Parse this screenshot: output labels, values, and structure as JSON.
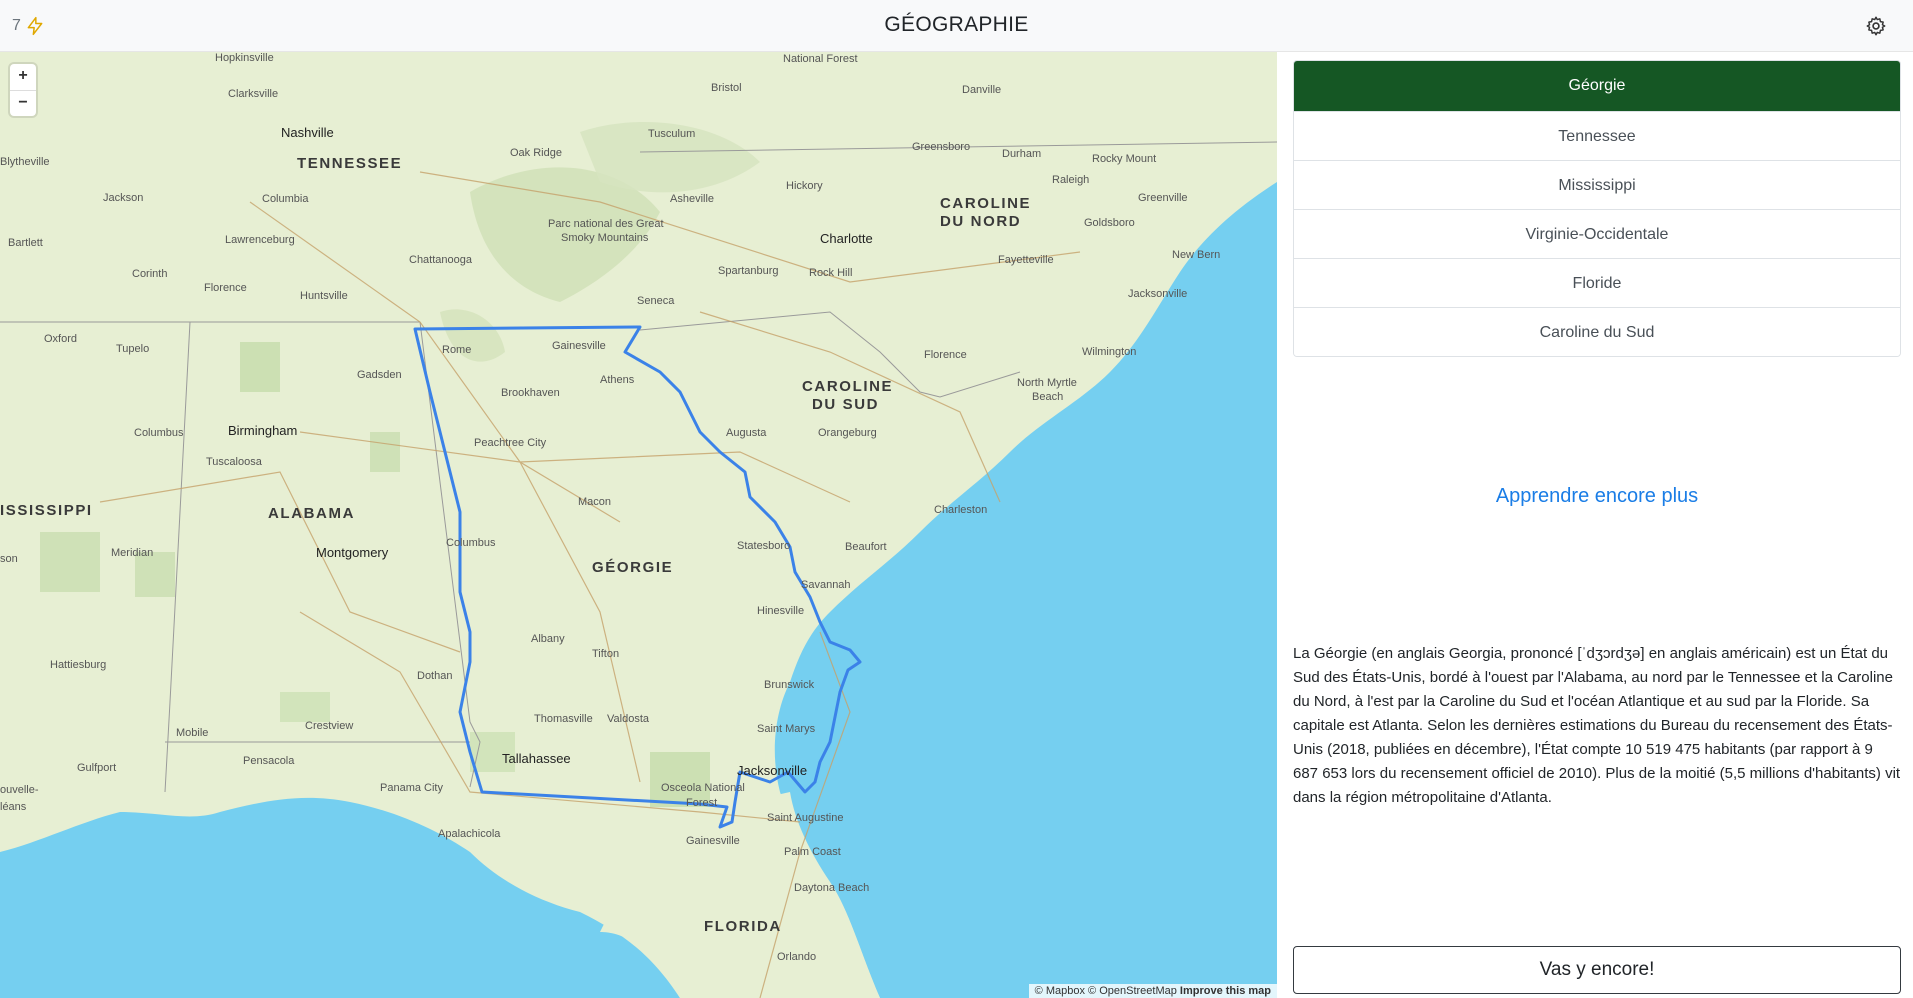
{
  "header": {
    "streak_count": "7",
    "title": "GÉOGRAPHIE"
  },
  "icons": {
    "streak": "lightning-bolt-icon",
    "settings": "gear-icon"
  },
  "map": {
    "zoom_in": "+",
    "zoom_out": "−",
    "attribution": {
      "mapbox": "© Mapbox",
      "osm": "© OpenStreetMap",
      "improve": "Improve this map"
    },
    "highlight_color": "#3b82e8",
    "water_color": "#75cff0",
    "land_color": "#e7efd3",
    "state_labels": {
      "tennessee": "TENNESSEE",
      "caroline_nord_1": "CAROLINE",
      "caroline_nord_2": "DU NORD",
      "caroline_sud_1": "CAROLINE",
      "caroline_sud_2": "DU SUD",
      "mississippi": "ISSISSIPPI",
      "alabama": "ALABAMA",
      "georgie": "GÉORGIE",
      "florida": "FLORIDA"
    },
    "places": {
      "hopkinsville": "Hopkinsville",
      "clarksville": "Clarksville",
      "nashville": "Nashville",
      "blytheville": "Blytheville",
      "jackson_tn": "Jackson",
      "columbia": "Columbia",
      "lawrenceburg": "Lawrenceburg",
      "bartlett": "Bartlett",
      "corinth": "Corinth",
      "florence_al": "Florence",
      "huntsville": "Huntsville",
      "chattanooga": "Chattanooga",
      "oxford": "Oxford",
      "tupelo": "Tupelo",
      "gadsden": "Gadsden",
      "rome": "Rome",
      "gainesville_ga": "Gainesville",
      "columbus_ms": "Columbus",
      "birmingham": "Birmingham",
      "tuscaloosa": "Tuscaloosa",
      "brookhaven": "Brookhaven",
      "athens": "Athens",
      "peachtree": "Peachtree City",
      "national_forest": "National Forest",
      "bristol": "Bristol",
      "danville": "Danville",
      "oak_ridge": "Oak Ridge",
      "tusculum": "Tusculum",
      "greensboro": "Greensboro",
      "durham": "Durham",
      "rocky_mount": "Rocky Mount",
      "raleigh": "Raleigh",
      "asheville": "Asheville",
      "hickory": "Hickory",
      "greenville": "Greenville",
      "smoky_1": "Parc national des Great",
      "smoky_2": "Smoky Mountains",
      "charlotte": "Charlotte",
      "goldsboro": "Goldsboro",
      "spartanburg": "Spartanburg",
      "rock_hill": "Rock Hill",
      "fayetteville": "Fayetteville",
      "new_bern": "New Bern",
      "seneca": "Seneca",
      "jacksonville_nc": "Jacksonville",
      "wilmington": "Wilmington",
      "florence_sc": "Florence",
      "myrtle_1": "North Myrtle",
      "myrtle_2": "Beach",
      "augusta": "Augusta",
      "orangeburg": "Orangeburg",
      "charleston": "Charleston",
      "macon": "Macon",
      "columbus_ga": "Columbus",
      "montgomery": "Montgomery",
      "meridian": "Meridian",
      "statesboro": "Statesboro",
      "beaufort": "Beaufort",
      "savannah": "Savannah",
      "hinesville": "Hinesville",
      "albany": "Albany",
      "tifton": "Tifton",
      "hattiesburg": "Hattiesburg",
      "dothan": "Dothan",
      "brunswick": "Brunswick",
      "crestview": "Crestview",
      "thomasville": "Thomasville",
      "valdosta": "Valdosta",
      "saint_marys": "Saint Marys",
      "mobile": "Mobile",
      "gulfport": "Gulfport",
      "pensacola": "Pensacola",
      "tallahassee": "Tallahassee",
      "jacksonville_fl": "Jacksonville",
      "osceola_1": "Osceola National",
      "osceola_2": "Forest",
      "panama_city": "Panama City",
      "nouvelle_1": "ouvelle-",
      "nouvelle_2": "léans",
      "saint_augustine": "Saint Augustine",
      "apalachicola": "Apalachicola",
      "gainesville_fl": "Gainesville",
      "palm_coast": "Palm Coast",
      "daytona": "Daytona Beach",
      "orlando": "Orlando",
      "son": "son"
    }
  },
  "choices": [
    {
      "label": "Géorgie",
      "selected": true
    },
    {
      "label": "Tennessee",
      "selected": false
    },
    {
      "label": "Mississippi",
      "selected": false
    },
    {
      "label": "Virginie-Occidentale",
      "selected": false
    },
    {
      "label": "Floride",
      "selected": false
    },
    {
      "label": "Caroline du Sud",
      "selected": false
    }
  ],
  "learn_more": "Apprendre encore plus",
  "description": "La Géorgie (en anglais Georgia, prononcé [ˈdʒɔrdʒə] en anglais américain) est un État du Sud des États-Unis, bordé à l'ouest par l'Alabama, au nord par le Tennessee et la Caroline du Nord, à l'est par la Caroline du Sud et l'océan Atlantique et au sud par la Floride. Sa capitale est Atlanta. Selon les dernières estimations du Bureau du recensement des États-Unis (2018, publiées en décembre), l'État compte 10 519 475 habitants (par rapport à 9 687 653 lors du recensement officiel de 2010). Plus de la moitié (5,5 millions d'habitants) vit dans la région métropolitaine d'Atlanta.",
  "again_button": "Vas y encore!",
  "colors": {
    "selected_choice": "#155724",
    "link": "#1a7de6"
  }
}
